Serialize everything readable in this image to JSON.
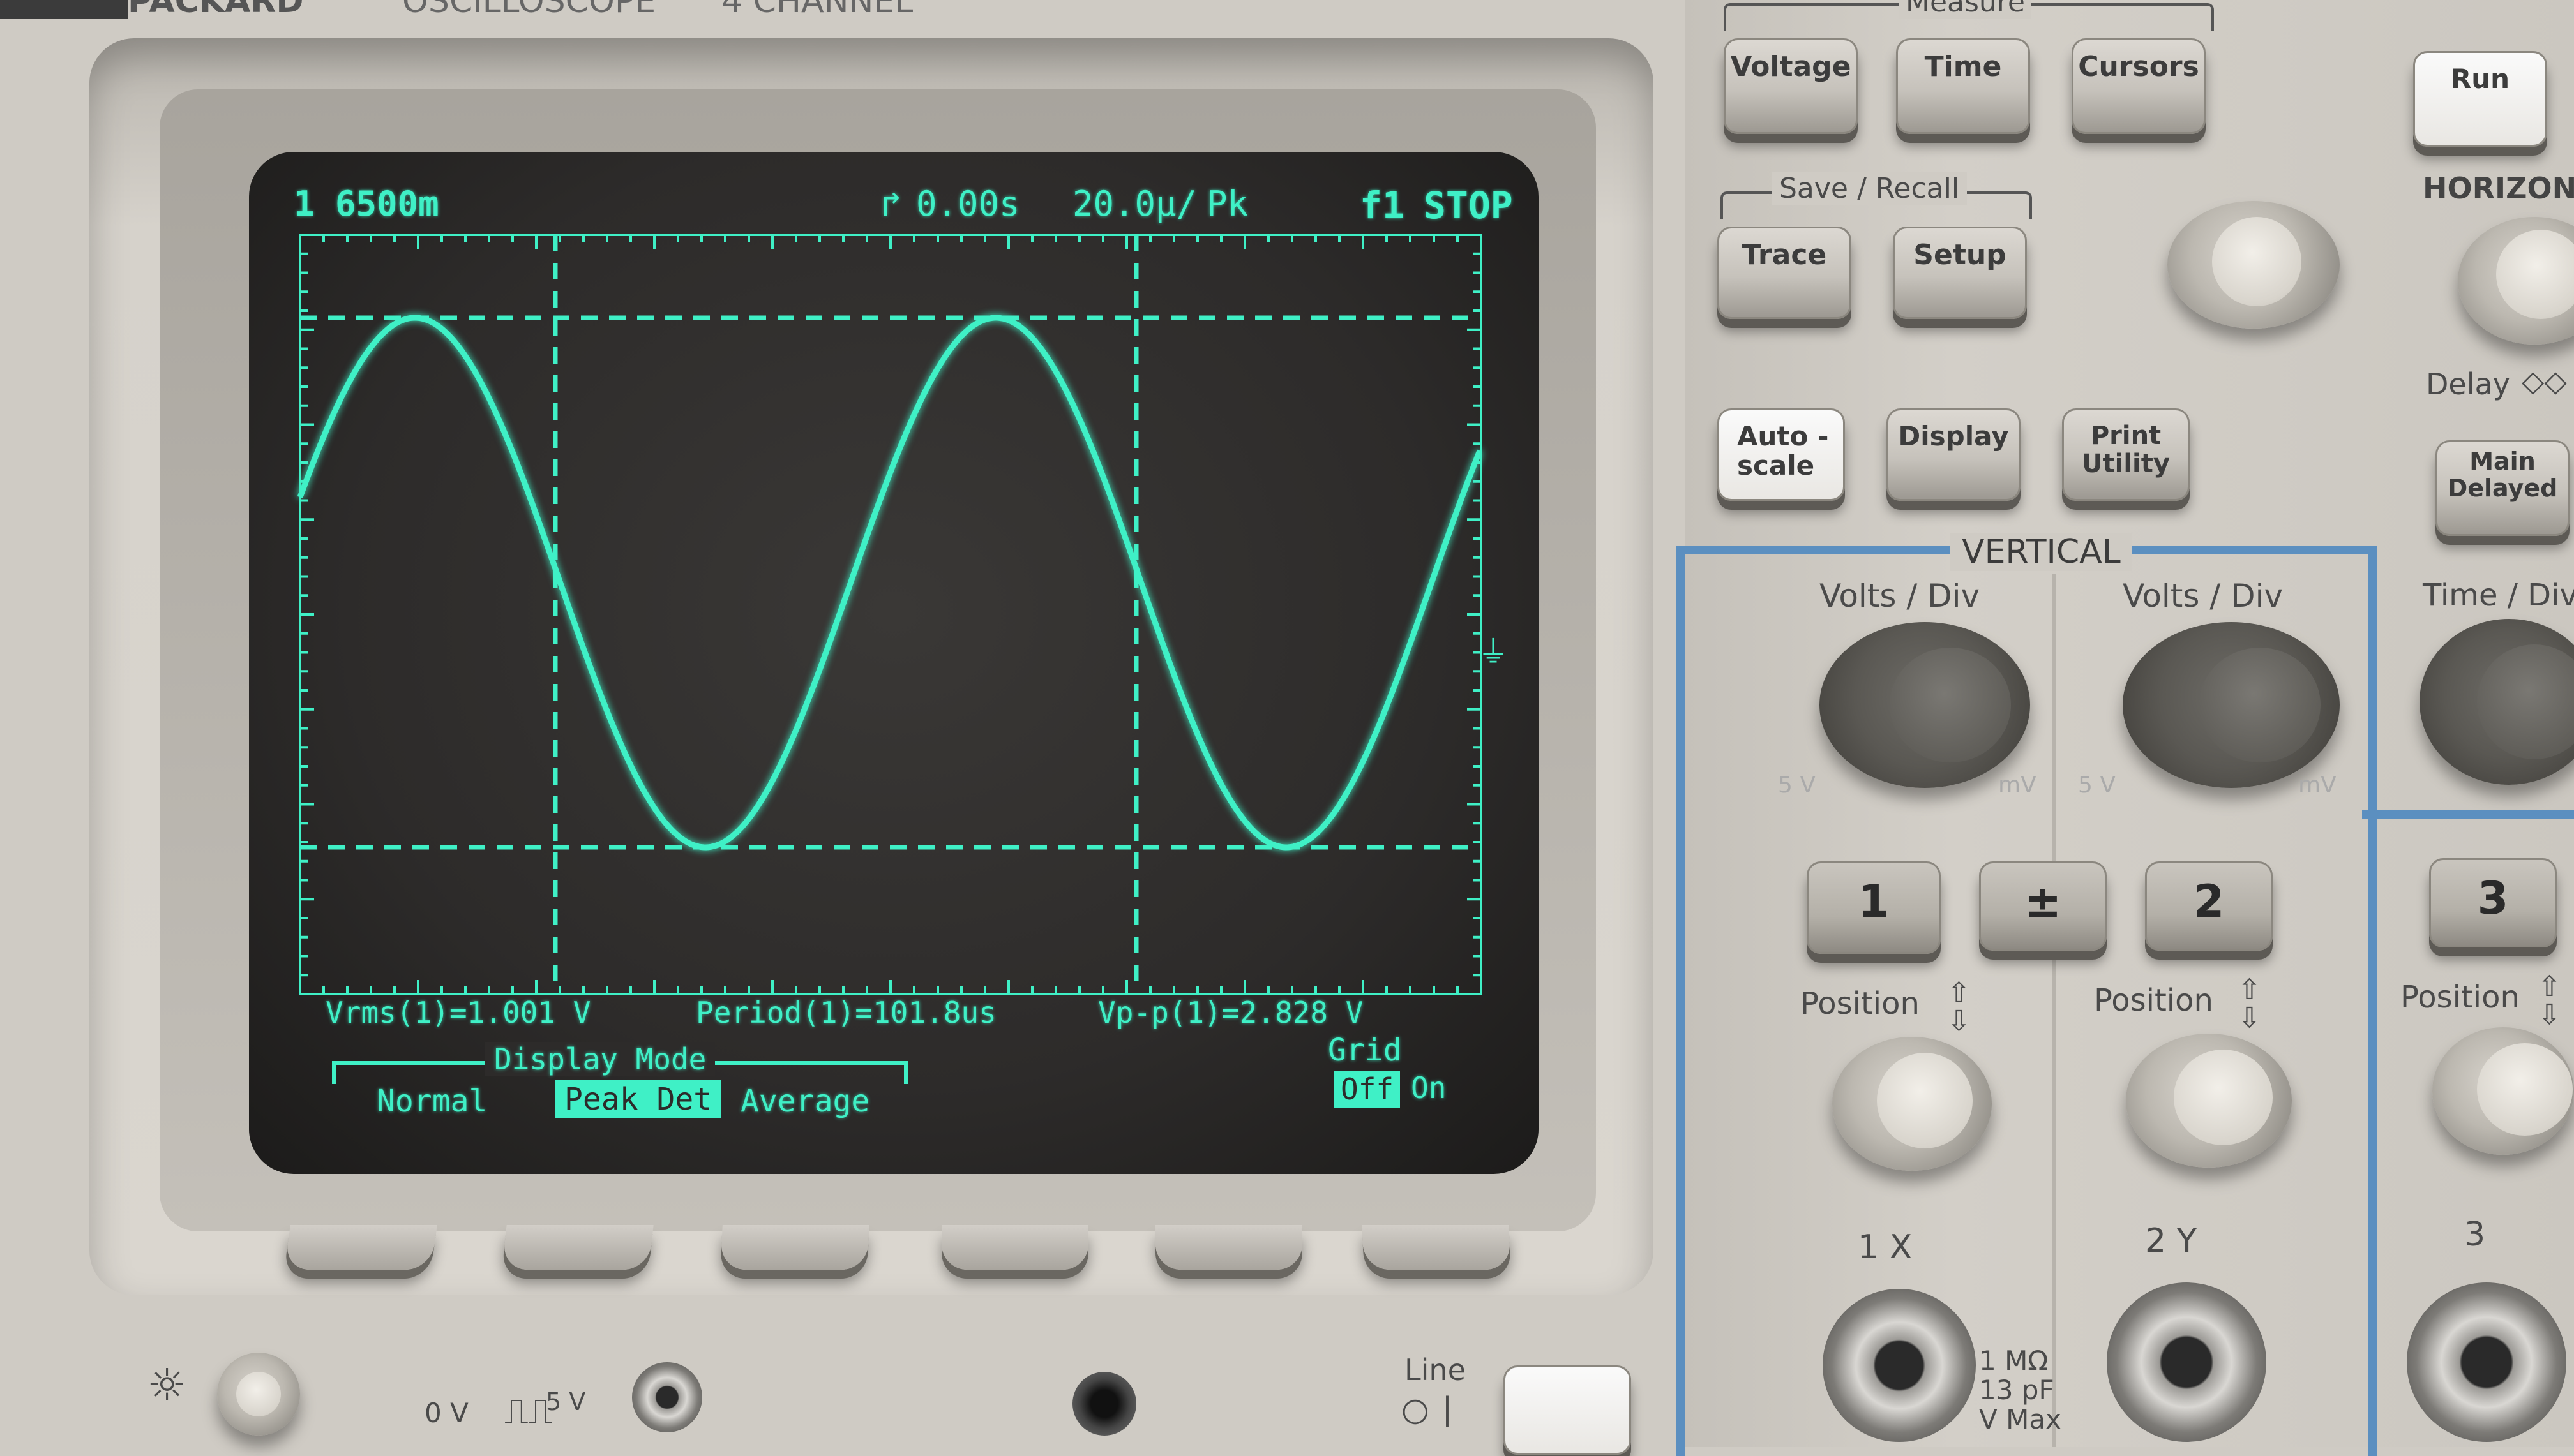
{
  "brand": {
    "partial_text": "PACKARD",
    "model_text": "OSCILLOSCOPE",
    "channel_text": "4 CHANNEL"
  },
  "screen": {
    "ch_scale": "1 6500m",
    "trigger_time": "0.00s",
    "timebase": "20.0µ/",
    "acq_mode_short": "Pk",
    "trigger_source": "f1",
    "run_state": "STOP",
    "measurements": [
      "Vrms(1)=1.001 V",
      "Period(1)=101.8us",
      "Vp-p(1)=2.828 V"
    ],
    "display_mode_title": "Display Mode",
    "display_modes": [
      "Normal",
      "Peak Det",
      "Average"
    ],
    "display_mode_selected": "Peak Det",
    "grid_title": "Grid",
    "grid_options": [
      "Off",
      "On"
    ],
    "grid_selected": "Off",
    "trace_color": "#3ff0c6",
    "screen_bg": "#2d2b2a"
  },
  "waveform": {
    "shape": "sine",
    "cycles_visible": 2.1,
    "vrms": 1.001,
    "vpp": 2.828,
    "period_us": 101.8
  },
  "measure": {
    "title": "Measure",
    "voltage": "Voltage",
    "time": "Time",
    "cursors": "Cursors"
  },
  "save_recall": {
    "title": "Save / Recall",
    "trace": "Trace",
    "setup": "Setup"
  },
  "misc": {
    "autoscale_1": "Auto -",
    "autoscale_2": "scale",
    "display": "Display",
    "print_1": "Print",
    "print_2": "Utility",
    "run": "Run"
  },
  "horizontal": {
    "title": "HORIZONTAL",
    "delay": "Delay",
    "main": "Main",
    "delayed": "Delayed",
    "time_div": "Time / Div"
  },
  "vertical": {
    "title": "VERTICAL",
    "volts_div": "Volts / Div",
    "scale_left": "5 V",
    "scale_right": "mV",
    "ch1": "1",
    "math": "±",
    "ch2": "2",
    "ch3": "3",
    "position": "Position",
    "input1": "1 X",
    "input2": "2 Y",
    "input3": "3",
    "input_spec": [
      "1 MΩ",
      "13 pF",
      "V Max"
    ]
  },
  "bottom": {
    "line": "Line",
    "probe_cal": "0 V",
    "probe_cal_v": "5 V"
  }
}
